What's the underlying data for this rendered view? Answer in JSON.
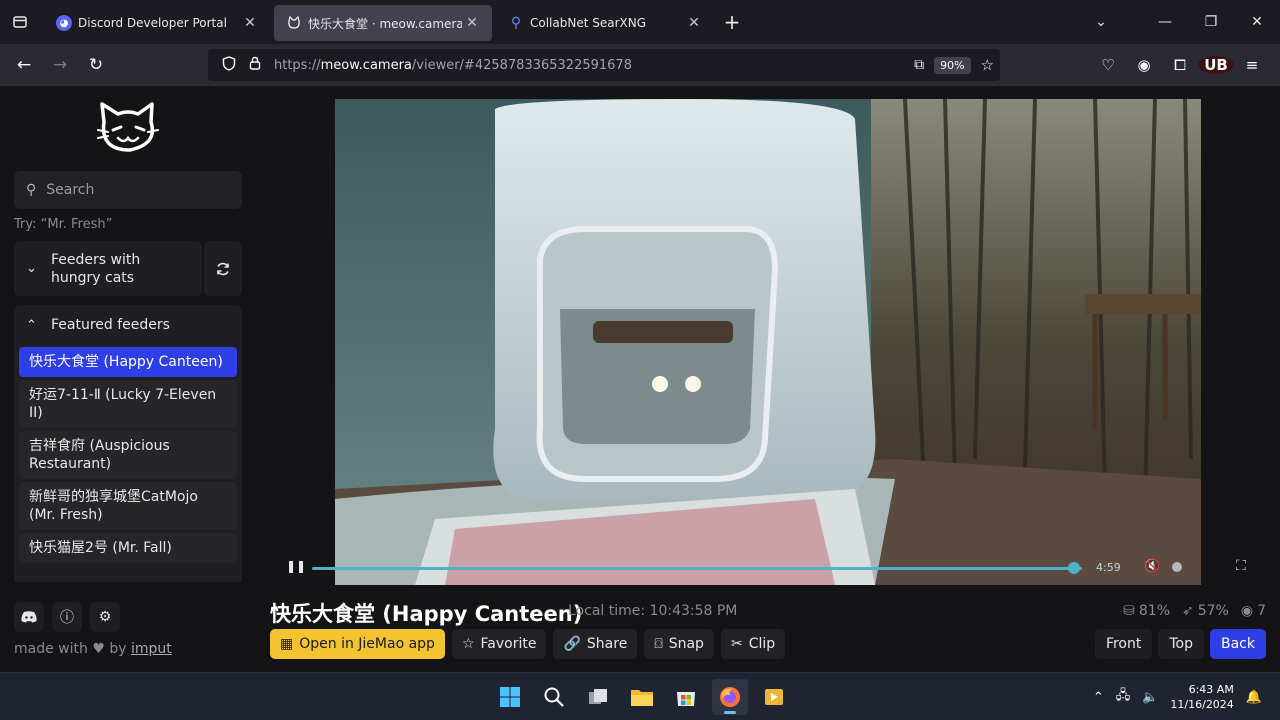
{
  "browser": {
    "tabs": [
      {
        "title": "Discord Developer Portal",
        "icon": "discord-icon",
        "color": "#5865f2"
      },
      {
        "title": "快乐大食堂 · meow.camera",
        "icon": "cat-icon",
        "color": "#42414d",
        "active": true
      },
      {
        "title": "CollabNet SearXNG",
        "icon": "search-icon",
        "color": "#3a6fe8"
      }
    ],
    "url_prefix": "https://",
    "url_domain": "meow.camera",
    "url_path": "/viewer/#4258783365322591678",
    "zoom": "90%",
    "ext_badge": "UB"
  },
  "sidebar": {
    "search_placeholder": "Search",
    "hint": "Try: “Mr. Fresh”",
    "hungry_group": "Feeders with hungry cats",
    "featured_group": "Featured feeders",
    "feeders": [
      {
        "label": "快乐大食堂 (Happy Canteen)",
        "selected": true
      },
      {
        "label": "好运7-11-Ⅱ (Lucky 7-Eleven II)"
      },
      {
        "label": "吉祥食府 (Auspicious Restaurant)"
      },
      {
        "label": "新鲜哥的独享城堡CatMojo (Mr. Fresh)"
      },
      {
        "label": "快乐猫屋2号 (Mr. Fall)"
      }
    ],
    "made_with": "made with",
    "by": "by",
    "author": "imput"
  },
  "player": {
    "time": "4:59",
    "progress": 0.99
  },
  "feeder": {
    "title": "快乐大食堂 (Happy Canteen)",
    "local_time": "Local time: 10:43:58 PM",
    "stat_food": "81%",
    "stat_signal": "57%",
    "stat_viewers": "7"
  },
  "actions": {
    "open_app": "Open in JieMao app",
    "favorite": "Favorite",
    "share": "Share",
    "snap": "Snap",
    "clip": "Clip"
  },
  "views": {
    "front": "Front",
    "top": "Top",
    "back": "Back",
    "selected": "Back"
  },
  "taskbar": {
    "time": "6:43 AM",
    "date": "11/16/2024"
  }
}
